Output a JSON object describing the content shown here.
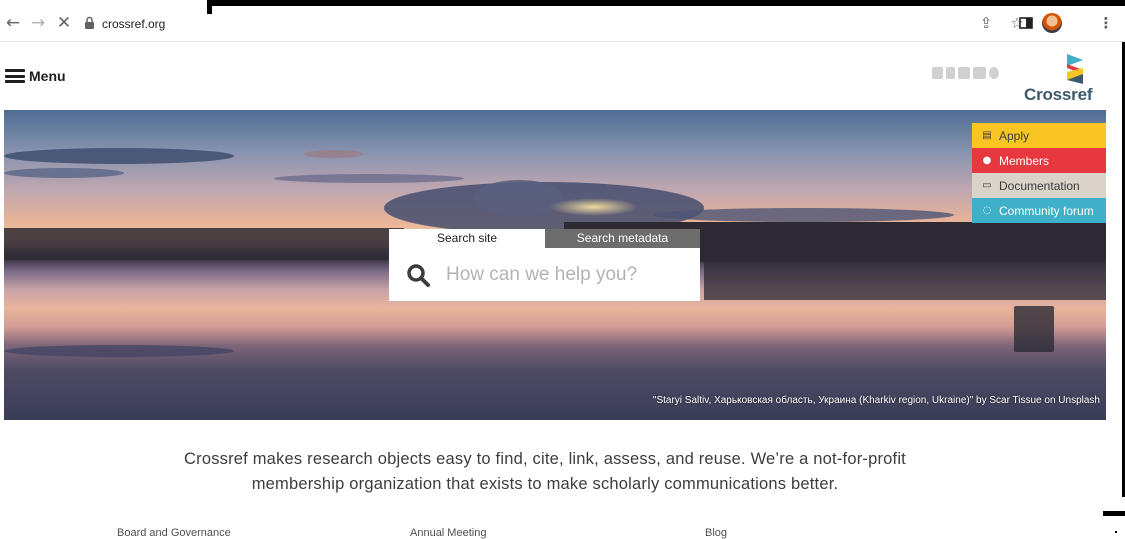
{
  "browser": {
    "url": "crossref.org",
    "icons": [
      "back-arrow-icon",
      "forward-arrow-icon",
      "stop-loading-icon",
      "lock-icon",
      "share-icon",
      "bookmark-star-icon",
      "side-panel-icon",
      "profile-avatar-icon",
      "more-menu-icon"
    ]
  },
  "header": {
    "menu_label": "Menu",
    "logo_text": "Crossref",
    "social_icons": [
      "twitter-icon",
      "facebook-icon",
      "linkedin-icon",
      "youtube-icon",
      "rss-icon"
    ]
  },
  "hero": {
    "photo_credit": "\"Staryi Saltiv, Харьковская область, Украина (Kharkiv region, Ukraine)\" by Scar Tissue on Unsplash"
  },
  "search": {
    "tabs": [
      {
        "label": "Search site",
        "active": true
      },
      {
        "label": "Search metadata",
        "active": false
      }
    ],
    "placeholder": "How can we help you?"
  },
  "quick_links": [
    {
      "label": "Apply",
      "color": "#f8c522",
      "text_color": "#3d3d3d",
      "icon": "book-icon"
    },
    {
      "label": "Members",
      "color": "#e8383f",
      "text_color": "#ffffff",
      "icon": "person-icon"
    },
    {
      "label": "Documentation",
      "color": "#d9d3c9",
      "text_color": "#3d3d3d",
      "icon": "document-icon"
    },
    {
      "label": "Community forum",
      "color": "#3eb1c8",
      "text_color": "#ffffff",
      "icon": "chat-icon"
    }
  ],
  "tagline": {
    "line1": "Crossref makes research objects easy to find, cite, link, assess, and reuse. We’re a not-for-profit",
    "line2": "membership organization that exists to make scholarly communications better."
  },
  "footer_links": [
    "Board and Governance",
    "Annual Meeting",
    "Blog"
  ],
  "colors": {
    "brand_yellow": "#f8c522",
    "brand_red": "#e8383f",
    "brand_teal": "#3eb1c8",
    "brand_dark": "#3d5a6c"
  }
}
